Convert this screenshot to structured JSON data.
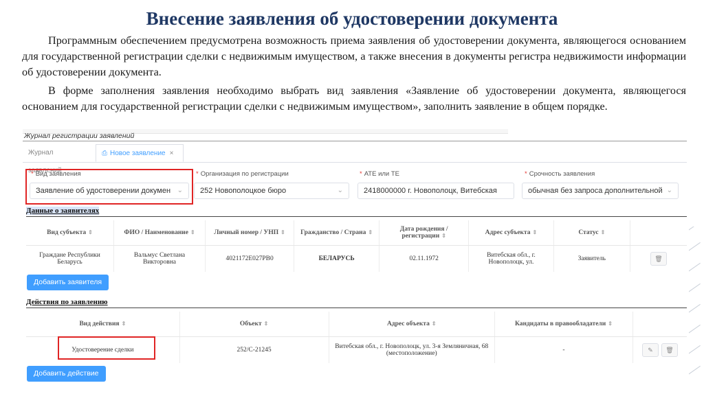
{
  "slide": {
    "title": "Внесение заявления об удостоверении документа",
    "paragraph1": "Программным обеспечением предусмотрена возможность приема заявления об удостоверении документа, являющегося основанием для государственной регистрации сделки с недвижимым имуществом, а также внесения в документы регистра недвижимости информации об удостоверении документа.",
    "paragraph2": "В форме заполнения заявления необходимо выбрать вид заявления «Заявление об удостоверении документа, являющегося основанием для государственной регистрации сделки с недвижимым имуществом», заполнить заявление в общем порядке."
  },
  "app": {
    "journal_title": "Журнал регистрации заявлений",
    "tabs": [
      {
        "label": "Журнал заявлений"
      },
      {
        "label": "Новое заявление",
        "close": "×"
      }
    ],
    "form": {
      "fields": [
        {
          "label": "Вид заявления",
          "required": "*",
          "value": "Заявление об удостоверении докумен"
        },
        {
          "label": "Организация по регистрации",
          "required": "*",
          "value": "252 Новополоцкое бюро"
        },
        {
          "label": "АТЕ или ТЕ",
          "required": "*",
          "value": "2418000000 г. Новополоцк, Витебская"
        },
        {
          "label": "Срочность заявления",
          "required": "*",
          "value": "обычная без запроса дополнительной"
        }
      ]
    },
    "applicants": {
      "section_title": "Данные о заявителях",
      "columns": [
        "Вид субъекта",
        "ФИО / Наименование",
        "Личный номер / УНП",
        "Гражданство / Страна",
        "Дата рождения / регистрации",
        "Адрес субъекта",
        "Статус"
      ],
      "rows": [
        [
          "Граждане Республики Беларусь",
          "Вальмус Светлана Викторовна",
          "4021172E027PB0",
          "БЕЛАРУСЬ",
          "02.11.1972",
          "Витебская обл., г. Новополоцк, ул.",
          "Заявитель"
        ]
      ],
      "add_button": "Добавить заявителя"
    },
    "actions": {
      "section_title": "Действия по заявлению",
      "columns": [
        "Вид действия",
        "Объект",
        "Адрес объекта",
        "Кандидаты в правообладатели"
      ],
      "rows": [
        [
          "Удостоверение сделки",
          "252/С-21245",
          "Витебская обл., г. Новополоцк, ул. 3-я Земляничная, 68 (местоположение)",
          "-"
        ]
      ],
      "add_button": "Добавить действие"
    }
  },
  "colors": {
    "accent": "#409eff",
    "highlight": "#e02424",
    "title": "#1f3864"
  },
  "icons": {
    "delete": "trash-icon",
    "edit": "edit-icon",
    "sort": "sort-icon",
    "dropdown": "chevron-down-icon"
  }
}
